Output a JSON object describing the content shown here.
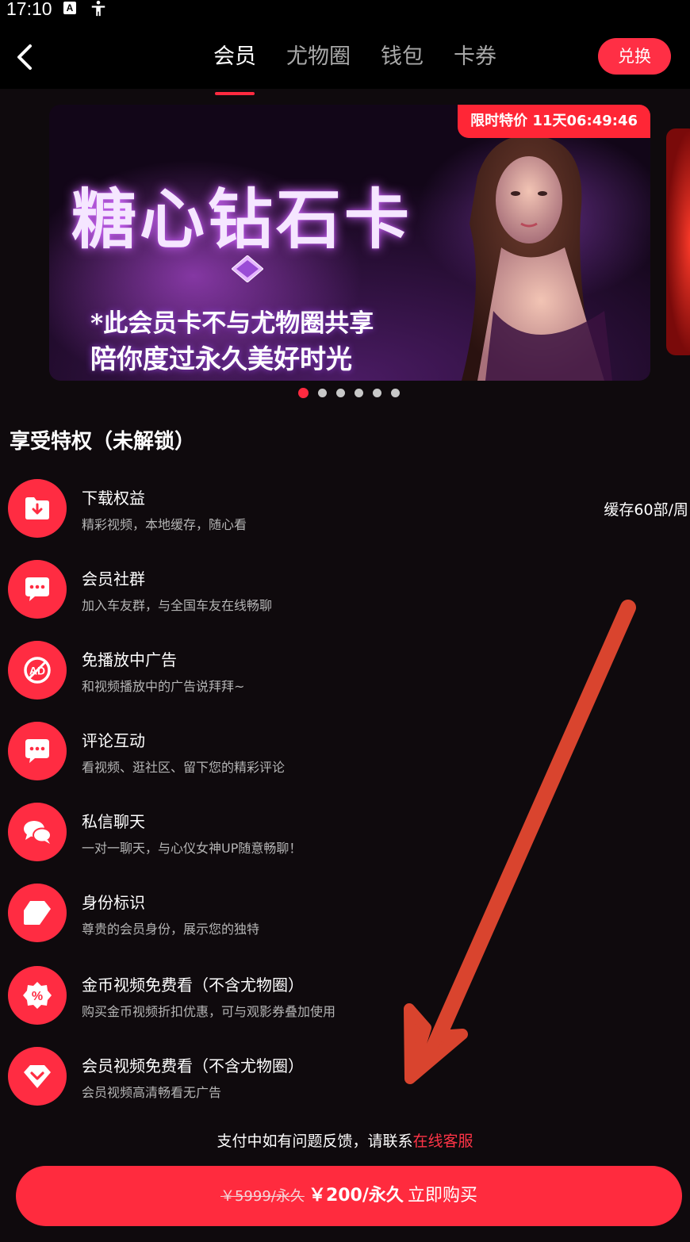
{
  "status_bar": {
    "time": "17:10",
    "keyboard_icon_letter": "A"
  },
  "header": {
    "tabs": [
      {
        "label": "会员",
        "active": true
      },
      {
        "label": "尤物圈",
        "active": false
      },
      {
        "label": "钱包",
        "active": false
      },
      {
        "label": "卡券",
        "active": false
      }
    ],
    "redeem_label": "兑换"
  },
  "banner": {
    "title": "糖心钻石卡",
    "subtitle1": "*此会员卡不与尤物圈共享",
    "subtitle2": "陪你度过永久美好时光",
    "promo_label": "限时特价 11天06:49:46",
    "slide_count": 6,
    "active_slide": 0
  },
  "privileges": {
    "heading": "享受特权（未解锁）",
    "items": [
      {
        "title": "下载权益",
        "desc": "精彩视频，本地缓存，随心看",
        "right": "缓存60部/周",
        "icon": "download-folder-icon"
      },
      {
        "title": "会员社群",
        "desc": "加入车友群，与全国车友在线畅聊",
        "right": "",
        "icon": "chat-bubble-icon"
      },
      {
        "title": "免播放中广告",
        "desc": "和视频播放中的广告说拜拜~",
        "right": "",
        "icon": "no-ad-icon"
      },
      {
        "title": "评论互动",
        "desc": "看视频、逛社区、留下您的精彩评论",
        "right": "",
        "icon": "comment-bubble-icon"
      },
      {
        "title": "私信聊天",
        "desc": "一对一聊天，与心仪女神UP随意畅聊！",
        "right": "",
        "icon": "private-chat-icon"
      },
      {
        "title": "身份标识",
        "desc": "尊贵的会员身份，展示您的独特",
        "right": "",
        "icon": "identity-badge-icon"
      },
      {
        "title": "金币视频免费看（不含尤物圈）",
        "desc": "购买金币视频折扣优惠，可与观影券叠加使用",
        "right": "",
        "icon": "discount-coin-icon"
      },
      {
        "title": "会员视频免费看（不含尤物圈）",
        "desc": "会员视频高清畅看无广告",
        "right": "",
        "icon": "vip-diamond-icon"
      }
    ]
  },
  "support": {
    "text": "支付中如有问题反馈，请联系",
    "link": "在线客服"
  },
  "purchase": {
    "old_price": "￥5999/永久",
    "price": "￥200/永久",
    "cta": "立即购买"
  },
  "colors": {
    "accent": "#ff2b3e",
    "background": "#0f0a0d",
    "annotation_arrow": "#d9442e"
  }
}
